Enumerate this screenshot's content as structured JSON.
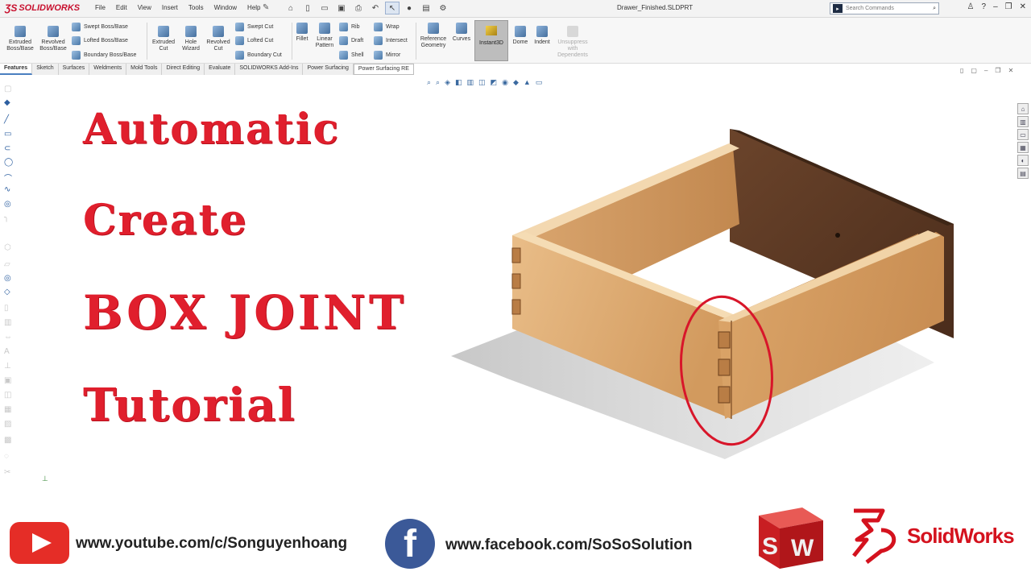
{
  "app": {
    "logo_text": "SOLIDWORKS",
    "document_title": "Drawer_Finished.SLDPRT"
  },
  "menu": [
    "File",
    "Edit",
    "View",
    "Insert",
    "Tools",
    "Window",
    "Help"
  ],
  "search": {
    "placeholder": "Search Commands"
  },
  "ribbon": {
    "extruded_boss": "Extruded Boss/Base",
    "revolved_boss": "Revolved Boss/Base",
    "swept_boss": "Swept Boss/Base",
    "lofted_boss": "Lofted Boss/Base",
    "boundary_boss": "Boundary Boss/Base",
    "extruded_cut": "Extruded Cut",
    "hole_wizard": "Hole Wizard",
    "revolved_cut": "Revolved Cut",
    "swept_cut": "Swept Cut",
    "lofted_cut": "Lofted Cut",
    "boundary_cut": "Boundary Cut",
    "fillet": "Fillet",
    "linear_pattern": "Linear Pattern",
    "rib": "Rib",
    "draft": "Draft",
    "shell": "Shell",
    "wrap": "Wrap",
    "intersect": "Intersect",
    "mirror": "Mirror",
    "reference_geometry": "Reference Geometry",
    "curves": "Curves",
    "instant3d": "Instant3D",
    "dome": "Dome",
    "indent": "Indent",
    "unsuppress": "Unsuppress with Dependents"
  },
  "tabs": [
    "Features",
    "Sketch",
    "Surfaces",
    "Weldments",
    "Mold Tools",
    "Direct Editing",
    "Evaluate",
    "SOLIDWORKS Add-Ins",
    "Power Surfacing",
    "Power Surfacing RE"
  ],
  "overlay": {
    "line1": "Automatic",
    "line2": "Create",
    "line3": "BOX JOINT",
    "line4": "Tutorial"
  },
  "footer": {
    "youtube_url": "www.youtube.com/c/Songuyenhoang",
    "facebook_url": "www.facebook.com/SoSoSolution",
    "fb_letter": "f",
    "brand_text": "SolidWorks",
    "cube_letters": "SW"
  },
  "colors": {
    "title_red": "#e01f2d",
    "youtube_red": "#e52d27",
    "facebook_blue": "#3b5998",
    "wood": "#d9a36a",
    "back_panel": "#5c3a24"
  },
  "icons": [
    "save-icon",
    "print-icon",
    "undo-icon",
    "select-icon",
    "gear-icon",
    "search-icon",
    "user-icon",
    "help-icon",
    "minimize-icon",
    "restore-icon",
    "close-icon"
  ]
}
